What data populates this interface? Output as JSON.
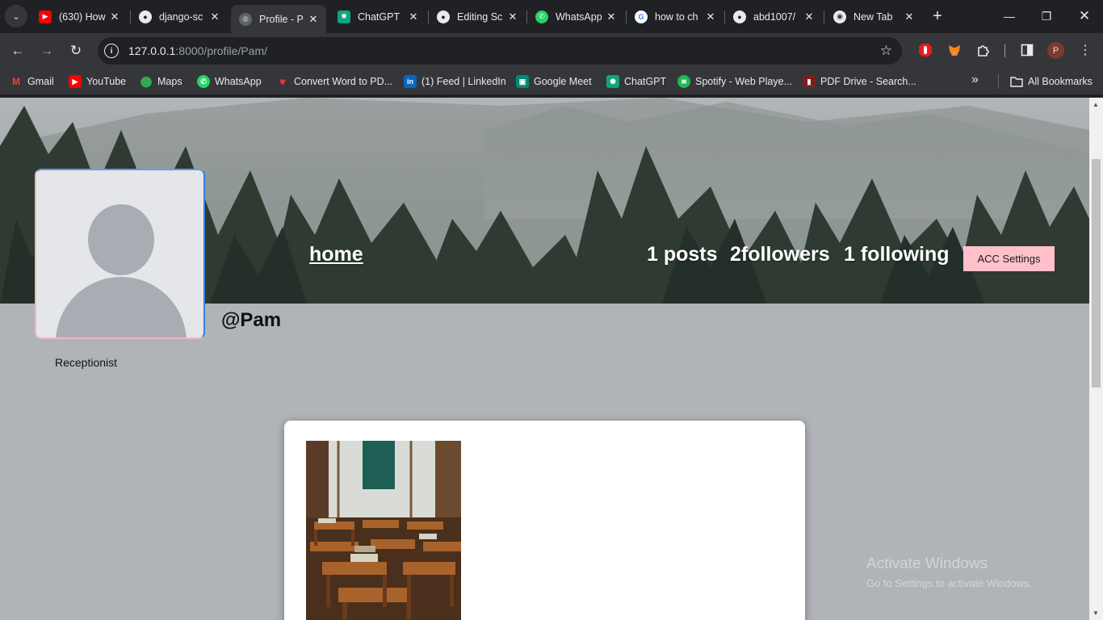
{
  "browser": {
    "tabs": [
      {
        "title": "(630) How",
        "icon": "youtube-icon",
        "active": false
      },
      {
        "title": "django-sc",
        "icon": "github-icon",
        "active": false
      },
      {
        "title": "Profile - P",
        "icon": "globe-icon",
        "active": true
      },
      {
        "title": "ChatGPT",
        "icon": "chatgpt-icon",
        "active": false
      },
      {
        "title": "Editing Sc",
        "icon": "github-icon",
        "active": false
      },
      {
        "title": "WhatsApp",
        "icon": "whatsapp-icon",
        "active": false
      },
      {
        "title": "how to ch",
        "icon": "google-icon",
        "active": false
      },
      {
        "title": "abd1007/",
        "icon": "github-icon",
        "active": false
      },
      {
        "title": "New Tab",
        "icon": "chrome-icon",
        "active": false
      }
    ],
    "address": {
      "host": "127.0.0.1",
      "path": ":8000/profile/Pam/"
    },
    "profile_initial": "P",
    "bookmarks": [
      {
        "label": "Gmail",
        "icon": "gmail-icon",
        "color": "#ea4335",
        "glyph": "M"
      },
      {
        "label": "YouTube",
        "icon": "youtube-icon",
        "color": "#ff0000",
        "glyph": "▶"
      },
      {
        "label": "Maps",
        "icon": "maps-icon",
        "color": "#34a853",
        "glyph": "●"
      },
      {
        "label": "WhatsApp",
        "icon": "whatsapp-icon",
        "color": "#25d366",
        "glyph": "✆"
      },
      {
        "label": "Convert Word to PD...",
        "icon": "heart-icon",
        "color": "#e53935",
        "glyph": "♥"
      },
      {
        "label": "(1) Feed | LinkedIn",
        "icon": "linkedin-icon",
        "color": "#0a66c2",
        "glyph": "in"
      },
      {
        "label": "Google Meet",
        "icon": "meet-icon",
        "color": "#00897b",
        "glyph": "▣"
      },
      {
        "label": "ChatGPT",
        "icon": "chatgpt-icon",
        "color": "#10a37f",
        "glyph": "✺"
      },
      {
        "label": "Spotify - Web Playe...",
        "icon": "spotify-icon",
        "color": "#1db954",
        "glyph": "≋"
      },
      {
        "label": "PDF Drive - Search...",
        "icon": "pdf-icon",
        "color": "#c62828",
        "glyph": "▮"
      }
    ],
    "all_bookmarks_label": "All Bookmarks"
  },
  "profile": {
    "home_label": "home",
    "posts": "1 posts",
    "followers": "2followers",
    "following": "1 following",
    "settings_button": "ACC Settings",
    "username": "@Pam",
    "bio": "Receptionist"
  },
  "os": {
    "watermark_title": "Activate Windows",
    "watermark_sub": "Go to Settings to activate Windows."
  }
}
